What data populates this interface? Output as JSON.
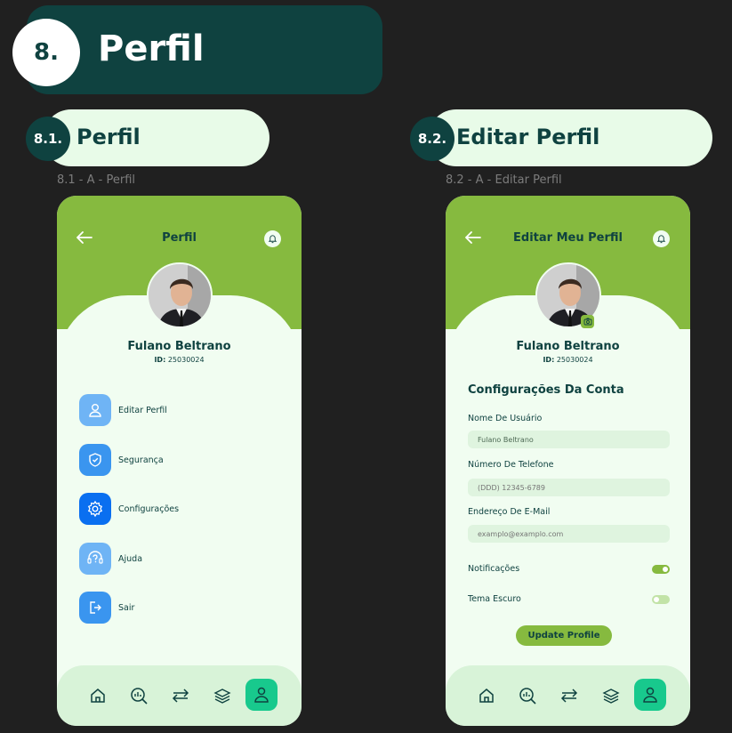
{
  "section": {
    "number": "8.",
    "title": "Perfil"
  },
  "left": {
    "pill_number": "8.1.",
    "pill_title": "Perfil",
    "caption": "8.1 - A - Perfil",
    "screen_title": "Perfil",
    "user": {
      "name": "Fulano Beltrano",
      "id_label": "ID:",
      "id_value": "25030024"
    },
    "menu": [
      {
        "label": "Editar Perfil",
        "icon": "user-icon",
        "color": "#6fb4f5"
      },
      {
        "label": "Segurança",
        "icon": "shield-icon",
        "color": "#3a95ef"
      },
      {
        "label": "Configurações",
        "icon": "gear-icon",
        "color": "#0a6ff0"
      },
      {
        "label": "Ajuda",
        "icon": "help-icon",
        "color": "#6fb4f5"
      },
      {
        "label": "Sair",
        "icon": "logout-icon",
        "color": "#3a95ef"
      }
    ]
  },
  "right": {
    "pill_number": "8.2.",
    "pill_title": "Editar Perfil",
    "caption": "8.2 - A - Editar Perfil",
    "screen_title": "Editar Meu Perfil",
    "user": {
      "name": "Fulano Beltrano",
      "id_label": "ID:",
      "id_value": "25030024"
    },
    "section_title": "Configurações Da Conta",
    "fields": [
      {
        "label": "Nome De Usuário",
        "value": "Fulano Beltrano",
        "placeholder": ""
      },
      {
        "label": "Número De Telefone",
        "value": "",
        "placeholder": "(DDD) 12345-6789"
      },
      {
        "label": "Endereço De E-Mail",
        "value": "",
        "placeholder": "examplo@examplo.com"
      }
    ],
    "toggles": [
      {
        "label": "Notificações",
        "on": true
      },
      {
        "label": "Tema Escuro",
        "on": false
      }
    ],
    "update_button": "Update Profile"
  },
  "nav_icons": [
    "home-icon",
    "analytics-icon",
    "transfer-icon",
    "layers-icon",
    "profile-icon"
  ],
  "colors": {
    "brand_dark": "#0f4240",
    "brand_green": "#86ba3f",
    "accent": "#18c98d",
    "panel": "#f1fdf1"
  }
}
